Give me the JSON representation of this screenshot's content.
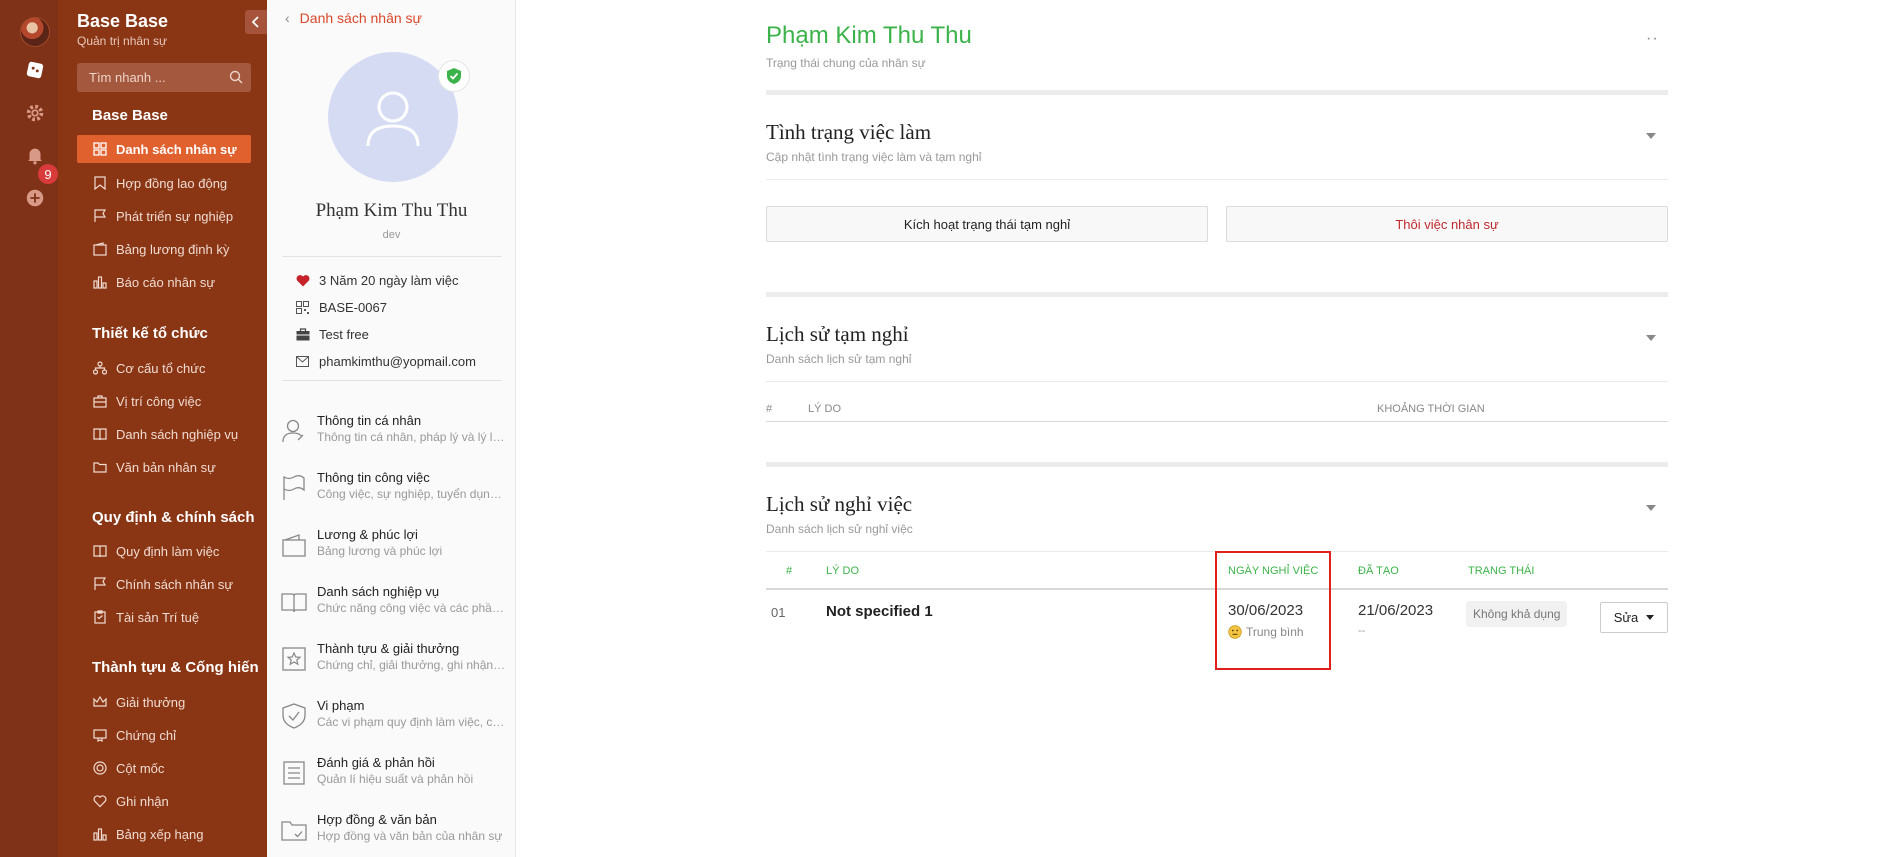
{
  "nav": {
    "brand": "Base Base",
    "brand_sub": "Quản trị nhân sự",
    "search_placeholder": "Tìm nhanh ...",
    "notification_count": "9",
    "sections": [
      {
        "title": "Base Base",
        "items": [
          "Danh sách nhân sự",
          "Hợp đồng lao động",
          "Phát triển sự nghiệp",
          "Bảng lương định kỳ",
          "Báo cáo nhân sự"
        ]
      },
      {
        "title": "Thiết kế tổ chức",
        "items": [
          "Cơ cấu tổ chức",
          "Vị trí công việc",
          "Danh sách nghiệp vụ",
          "Văn bản nhân sự"
        ]
      },
      {
        "title": "Quy định & chính sách",
        "items": [
          "Quy định làm việc",
          "Chính sách nhân sự",
          "Tài sản Trí tuệ"
        ]
      },
      {
        "title": "Thành tựu & Cống hiến",
        "items": [
          "Giải thưởng",
          "Chứng chỉ",
          "Cột mốc",
          "Ghi nhận",
          "Bảng xếp hạng"
        ]
      }
    ]
  },
  "profile": {
    "back_label": "Danh sách nhân sự",
    "name": "Phạm Kim Thu Thu",
    "role": "dev",
    "tenure": "3 Năm 20 ngày làm việc",
    "code": "BASE-0067",
    "type": "Test free",
    "email": "phamkimthu@yopmail.com",
    "menu": [
      {
        "title": "Thông tin cá nhân",
        "sub": "Thông tin cá nhân, pháp lý và lý lịch"
      },
      {
        "title": "Thông tin công việc",
        "sub": "Công việc, sự nghiệp, tuyển dụng ..."
      },
      {
        "title": "Lương & phúc lợi",
        "sub": "Bảng lương và phúc lợi"
      },
      {
        "title": "Danh sách nghiệp vụ",
        "sub": "Chức năng công việc và các phần..."
      },
      {
        "title": "Thành tựu & giải thưởng",
        "sub": "Chứng chỉ, giải thưởng, ghi nhận v..."
      },
      {
        "title": "Vi phạm",
        "sub": "Các vi phạm quy định làm việc, ch..."
      },
      {
        "title": "Đánh giá & phản hồi",
        "sub": "Quản lí hiệu suất và phản hồi"
      },
      {
        "title": "Hợp đồng & văn bản",
        "sub": "Hợp đồng và văn bản của nhân sự"
      }
    ]
  },
  "main": {
    "title": "Phạm Kim Thu Thu",
    "subtitle": "Trạng thái chung của nhân sự",
    "employment": {
      "title": "Tình trạng việc làm",
      "sub": "Cập nhật tình trạng việc làm và tạm nghỉ",
      "activate_label": "Kích hoạt trạng thái tạm nghỉ",
      "terminate_label": "Thôi việc nhân sự"
    },
    "leave_history": {
      "title": "Lịch sử tạm nghỉ",
      "sub": "Danh sách lịch sử tạm nghỉ",
      "col_num": "#",
      "col_reason": "LÝ DO",
      "col_period": "KHOẢNG THỜI GIAN"
    },
    "resign_history": {
      "title": "Lịch sử nghỉ việc",
      "sub": "Danh sách lịch sử nghỉ việc",
      "col_num": "#",
      "col_reason": "LÝ DO",
      "col_date": "NGÀY NGHỈ VIỆC",
      "col_created": "ĐÃ TẠO",
      "col_status": "TRẠNG THÁI",
      "row": {
        "num": "01",
        "reason": "Not specified 1",
        "date": "30/06/2023",
        "mood": "Trung bình",
        "created": "21/06/2023",
        "created_sub": "--",
        "status": "Không khả dụng",
        "edit_label": "Sửa"
      }
    }
  },
  "colors": {
    "rail": "#7f3217",
    "nav": "#8a3514",
    "active": "#e0602e",
    "accent_green": "#3cb34a",
    "danger": "#c0282d"
  }
}
